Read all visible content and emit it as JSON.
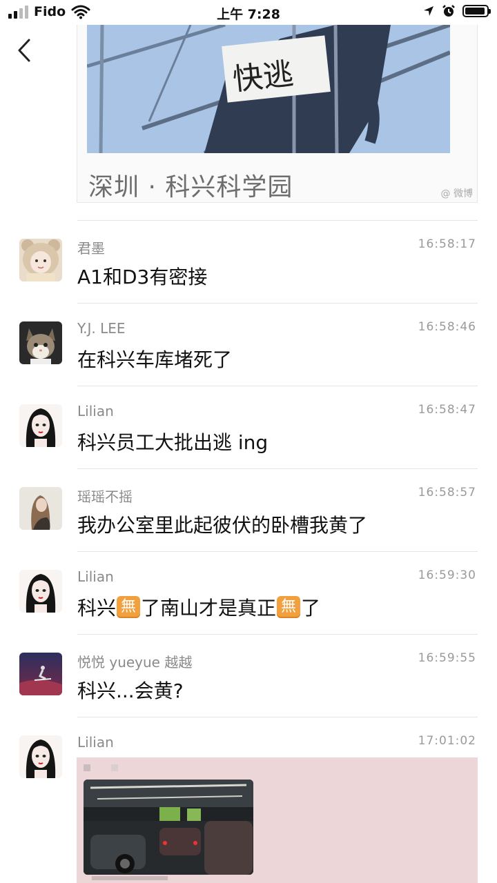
{
  "status_bar": {
    "carrier": "Fido",
    "time": "上午 7:28"
  },
  "top_image": {
    "sign_text": "快逃",
    "caption": "深圳 · 科兴科学园",
    "watermark": "@ 微博"
  },
  "messages": [
    {
      "sender": "君墨",
      "time": "16:58:17",
      "text": "A1和D3有密接",
      "avatar": "girl-bear-hat-avatar"
    },
    {
      "sender": "Y.J. LEE",
      "time": "16:58:46",
      "text": "在科兴车库堵死了",
      "avatar": "cat-avatar"
    },
    {
      "sender": "Lilian",
      "time": "16:58:47",
      "text": "科兴员工大批出逃 ing",
      "avatar": "anime-girl-avatar"
    },
    {
      "sender": "瑶瑶不摇",
      "time": "16:58:57",
      "text": "我办公室里此起彼伏的卧槽我黄了",
      "avatar": "girl-photo-avatar"
    },
    {
      "sender": "Lilian",
      "time": "16:59:30",
      "text_parts": [
        "科兴",
        "了南山才是真正",
        "了"
      ],
      "emoji_char": "無",
      "avatar": "anime-girl-avatar"
    },
    {
      "sender": "悦悦 yueyue 越越",
      "time": "16:59:55",
      "text": "科兴...会黄?",
      "avatar": "skier-avatar"
    },
    {
      "sender": "Lilian",
      "time": "17:01:02",
      "avatar": "anime-girl-avatar",
      "attachment": "garage-photo"
    }
  ]
}
